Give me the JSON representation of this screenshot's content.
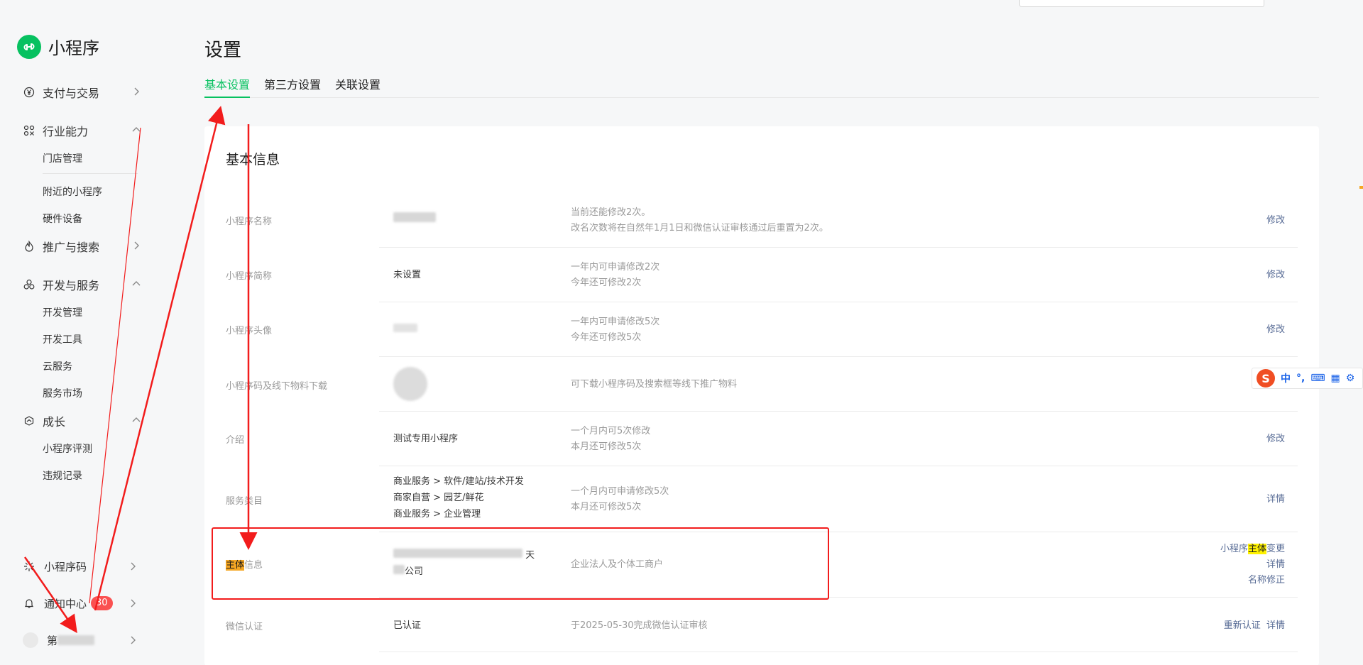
{
  "brand": {
    "title": "小程序"
  },
  "sidebar": {
    "groups": [
      {
        "label": "支付与交易",
        "icon": "yuan-icon",
        "expanded": false,
        "items": []
      },
      {
        "label": "行业能力",
        "icon": "grid-icon",
        "expanded": true,
        "items": [
          "门店管理",
          "附近的小程序",
          "硬件设备"
        ]
      },
      {
        "label": "推广与搜索",
        "icon": "flame-icon",
        "expanded": false,
        "items": []
      },
      {
        "label": "开发与服务",
        "icon": "cluster-icon",
        "expanded": true,
        "items": [
          "开发管理",
          "开发工具",
          "云服务",
          "服务市场"
        ]
      },
      {
        "label": "成长",
        "icon": "growth-icon",
        "expanded": true,
        "items": [
          "小程序评测",
          "违规记录"
        ]
      }
    ],
    "bottom": {
      "code": "小程序码",
      "notification": "通知中心",
      "notification_count": "30",
      "account": "第"
    }
  },
  "page": {
    "title": "设置"
  },
  "tabs": [
    {
      "label": "基本设置",
      "active": true
    },
    {
      "label": "第三方设置",
      "active": false
    },
    {
      "label": "关联设置",
      "active": false
    }
  ],
  "section": {
    "title": "基本信息"
  },
  "rows": {
    "name": {
      "label": "小程序名称",
      "desc1": "当前还能修改2次。",
      "desc2": "改名次数将在自然年1月1日和微信认证审核通过后重置为2次。",
      "action": "修改"
    },
    "short_name": {
      "label": "小程序简称",
      "value": "未设置",
      "desc1": "一年内可申请修改2次",
      "desc2": "今年还可修改2次",
      "action": "修改"
    },
    "avatar": {
      "label": "小程序头像",
      "desc1": "一年内可申请修改5次",
      "desc2": "今年还可修改5次",
      "action": "修改"
    },
    "qrcode": {
      "label": "小程序码及线下物料下载",
      "desc1": "可下载小程序码及搜索框等线下推广物料"
    },
    "intro": {
      "label": "介绍",
      "value": "测试专用小程序",
      "desc1": "一个月内可5次修改",
      "desc2": "本月还可修改5次",
      "action": "修改"
    },
    "category": {
      "label": "服务类目",
      "values": [
        "商业服务 > 软件/建站/技术开发",
        "商家自营 > 园艺/鲜花",
        "商业服务 > 企业管理"
      ],
      "desc1": "一个月内可申请修改5次",
      "desc2": "本月还可修改5次",
      "action": "详情"
    },
    "subject": {
      "label_highlight": "主体",
      "label_rest": "信息",
      "value_tail1": "天",
      "value_tail2": "公司",
      "desc1": "企业法人及个体工商户",
      "action1_pre": "小程序",
      "action1_hl": "主体",
      "action1_post": "变更",
      "action2": "详情",
      "action3": "名称修正"
    },
    "wechat_verify": {
      "label": "微信认证",
      "value": "已认证",
      "desc1": "于2025-05-30完成微信认证审核",
      "action1": "重新认证",
      "action2": "详情"
    }
  },
  "ime": {
    "items": [
      "中",
      "°,",
      "⌨",
      "▦",
      "⚙"
    ]
  }
}
